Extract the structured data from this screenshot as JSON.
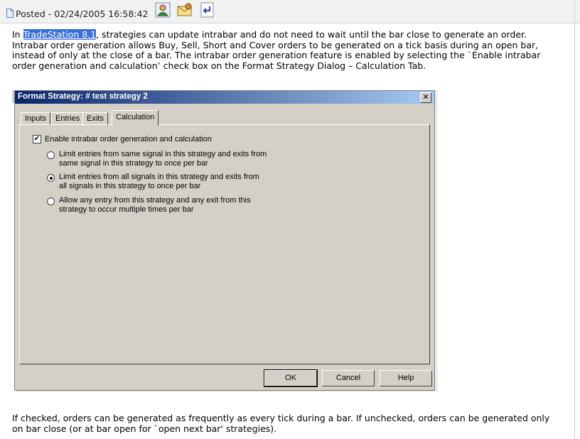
{
  "post": {
    "meta": "Posted - 02/24/2005 16:58:42"
  },
  "icons": {
    "post": "document-icon",
    "profile": "user-profile-icon",
    "message": "envelope-icon",
    "reply": "reply-icon"
  },
  "article": {
    "highlight": "TradeStation 8.1",
    "para1_rest": ", strategies can update intrabar and do not need to wait until the bar close to generate an order. Intrabar order generation allows Buy, Sell, Short and Cover orders to be generated on a tick basis during an open bar, instead of only at the close of a bar. The intrabar order generation feature is enabled by selecting the `Enable intrabar order generation and calculation’ check box on the Format Strategy Dialog – Calculation Tab.",
    "para1_prefix": "In ",
    "para2": "If checked, orders can be generated as frequently as every tick during a bar. If unchecked, orders can be generated only on bar close (or at bar open for `open next bar' strategies)."
  },
  "dialog": {
    "title": "Format Strategy: #  test strategy 2",
    "close_label": "✕",
    "tabs": [
      "Inputs",
      "Entries",
      "Exits",
      "Calculation"
    ],
    "active_tab": "Calculation",
    "checkbox_label": "Enable intrabar order generation and calculation",
    "checkbox_checked": true,
    "radios": [
      {
        "line1": "Limit entries from same signal in this strategy and exits from",
        "line2": "same signal in this strategy to once per bar",
        "selected": false
      },
      {
        "line1": "Limit entries from all signals in this strategy and exits from",
        "line2": "all signals in this strategy to once per bar",
        "selected": true
      },
      {
        "line1": "Allow any entry from this strategy and any exit from this",
        "line2": "strategy to occur multiple times per bar",
        "selected": false
      }
    ],
    "buttons": {
      "ok": "OK",
      "cancel": "Cancel",
      "help": "Help"
    }
  },
  "colors": {
    "titlebar_start": "#0a246a",
    "titlebar_end": "#a6caf0",
    "highlight": "#3a6fd6",
    "dialog_bg": "#d4d0c8"
  }
}
